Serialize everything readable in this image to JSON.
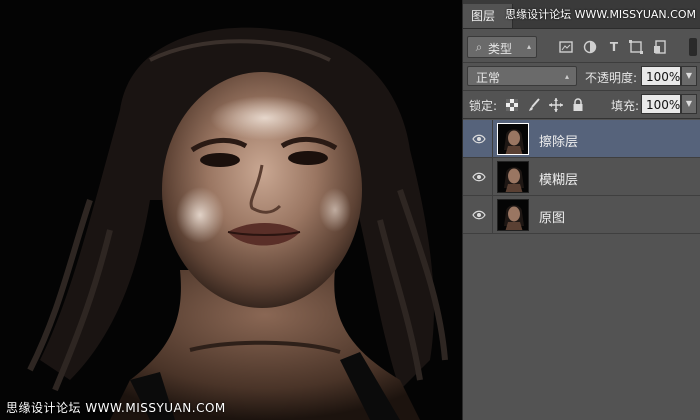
{
  "watermark": {
    "top": "思缘设计论坛 WWW.MISSYUAN.COM",
    "bottom": "思缘设计论坛 WWW.MISSYUAN.COM"
  },
  "panel": {
    "tab_label": "图层",
    "filter_label": "类型",
    "filter_icons": [
      "image-filter-icon",
      "adjustment-filter-icon",
      "type-filter-icon",
      "shape-filter-icon",
      "smart-object-filter-icon"
    ],
    "blend_mode": "正常",
    "opacity_label": "不透明度:",
    "opacity_value": "100%",
    "lock_label": "锁定:",
    "lock_icons": [
      "lock-transparent-icon",
      "lock-paint-icon",
      "lock-position-icon",
      "lock-all-icon"
    ],
    "fill_label": "填充:",
    "fill_value": "100%",
    "layers": [
      {
        "name": "擦除层",
        "selected": true,
        "visible": true
      },
      {
        "name": "模糊层",
        "selected": false,
        "visible": true
      },
      {
        "name": "原图",
        "selected": false,
        "visible": true
      }
    ]
  },
  "colors": {
    "panel_bg": "#535353",
    "selected_layer": "#56637b",
    "canvas_bg": "#050505"
  }
}
